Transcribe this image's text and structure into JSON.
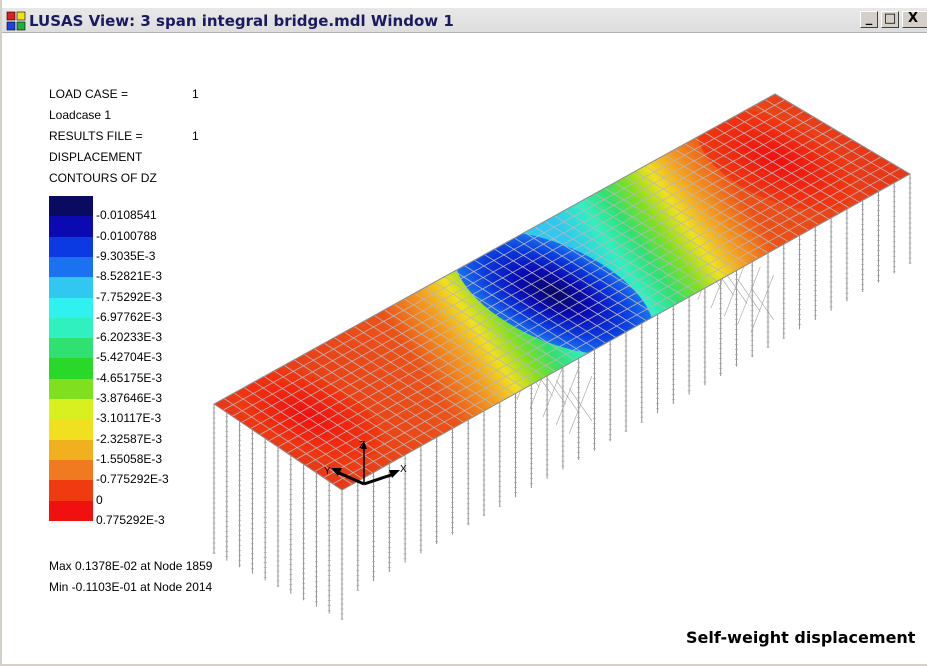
{
  "window": {
    "title": "LUSAS View: 3 span integral bridge.mdl Window 1",
    "buttons": {
      "minimize": "_",
      "maximize": "□",
      "close": "X"
    }
  },
  "info": {
    "load_case_label": "LOAD CASE   =",
    "load_case_value": "1",
    "loadcase_name": "Loadcase 1",
    "results_file_label": "RESULTS FILE =",
    "results_file_value": "1",
    "quantity": "DISPLACEMENT",
    "contours": "CONTOURS OF DZ"
  },
  "legend": {
    "colors": [
      "#0a0a60",
      "#0a0ab0",
      "#0a3ae0",
      "#1a72f0",
      "#30c8f0",
      "#30f0f0",
      "#30f0c0",
      "#30e070",
      "#2ad82a",
      "#80e020",
      "#d8f020",
      "#f0e020",
      "#f0b020",
      "#f07a20",
      "#f03a10",
      "#f01010"
    ],
    "levels": [
      "-0.0108541",
      "-0.0100788",
      "-9.3035E-3",
      "-8.52821E-3",
      "-7.75292E-3",
      "-6.97762E-3",
      "-6.20233E-3",
      "-5.42704E-3",
      "-4.65175E-3",
      "-3.87646E-3",
      "-3.10117E-3",
      "-2.32587E-3",
      "-1.55058E-3",
      "-0.775292E-3",
      "0",
      "0.775292E-3"
    ]
  },
  "extremes": {
    "max": "Max 0.1378E-02 at Node 1859",
    "min": "Min -0.1103E-01 at Node 2014"
  },
  "axes": {
    "z": "Z",
    "x": "X",
    "y": "Y"
  },
  "caption": "Self-weight displacement"
}
